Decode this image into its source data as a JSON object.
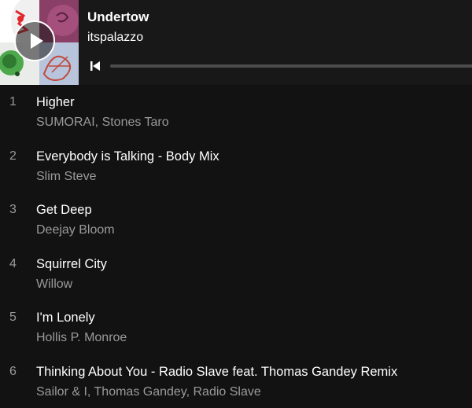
{
  "player": {
    "album_title": "Undertow",
    "artist": "itspalazzo",
    "play_icon": "play-icon",
    "previous_icon": "skip-previous-icon",
    "progress": 0.0
  },
  "tracks": [
    {
      "number": "1",
      "title": "Higher",
      "artists": "SUMORAI, Stones Taro"
    },
    {
      "number": "2",
      "title": "Everybody is Talking - Body Mix",
      "artists": "Slim Steve"
    },
    {
      "number": "3",
      "title": "Get Deep",
      "artists": "Deejay Bloom"
    },
    {
      "number": "4",
      "title": "Squirrel City",
      "artists": "Willow"
    },
    {
      "number": "5",
      "title": "I'm Lonely",
      "artists": "Hollis P. Monroe"
    },
    {
      "number": "6",
      "title": "Thinking About You - Radio Slave feat. Thomas Gandey Remix",
      "artists": "Sailor & I, Thomas Gandey, Radio Slave"
    }
  ],
  "colors": {
    "background": "#121212",
    "header_background": "#181818",
    "primary_text": "#ffffff",
    "secondary_text": "#9a9a9a",
    "progress_track": "#4d4d4d"
  }
}
